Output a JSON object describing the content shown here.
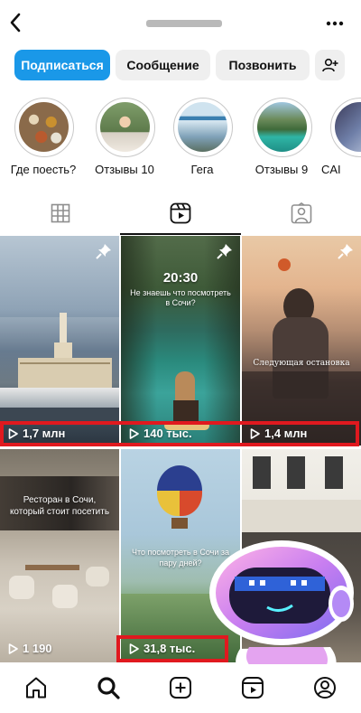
{
  "header": {
    "back_icon": "chevron-left-icon",
    "more_icon": "ellipsis-icon"
  },
  "actions": {
    "follow_label": "Подписаться",
    "message_label": "Сообщение",
    "call_label": "Позвонить",
    "add_friend_icon": "add-person-icon"
  },
  "highlights": [
    {
      "label": "Где поесть?"
    },
    {
      "label": "Отзывы 10"
    },
    {
      "label": "Гега"
    },
    {
      "label": "Отзывы 9"
    },
    {
      "label": "CAI"
    }
  ],
  "tabs": [
    {
      "icon": "grid-icon",
      "active": false
    },
    {
      "icon": "reels-icon",
      "active": true
    },
    {
      "icon": "tagged-icon",
      "active": false
    }
  ],
  "reels": [
    {
      "views": "1,7 млн",
      "pinned": true,
      "text": ""
    },
    {
      "views": "140 тыс.",
      "pinned": true,
      "text": "20:30",
      "subtext": "Не знаешь что посмотреть в Сочи?"
    },
    {
      "views": "1,4 млн",
      "pinned": true,
      "text": "Следующая остановка"
    },
    {
      "views": "1 190",
      "pinned": false,
      "text": "Ресторан в Сочи, который стоит посетить"
    },
    {
      "views": "31,8 тыс.",
      "pinned": false,
      "text": "Что посмотреть в Сочи за пару дней?"
    },
    {
      "views": "",
      "pinned": false,
      "text": ""
    }
  ],
  "bottom_nav": [
    {
      "icon": "home-icon"
    },
    {
      "icon": "search-icon"
    },
    {
      "icon": "create-icon"
    },
    {
      "icon": "reels-icon"
    },
    {
      "icon": "profile-icon"
    }
  ],
  "colors": {
    "accent": "#1a98e8",
    "highlight_box": "#e0191f"
  }
}
